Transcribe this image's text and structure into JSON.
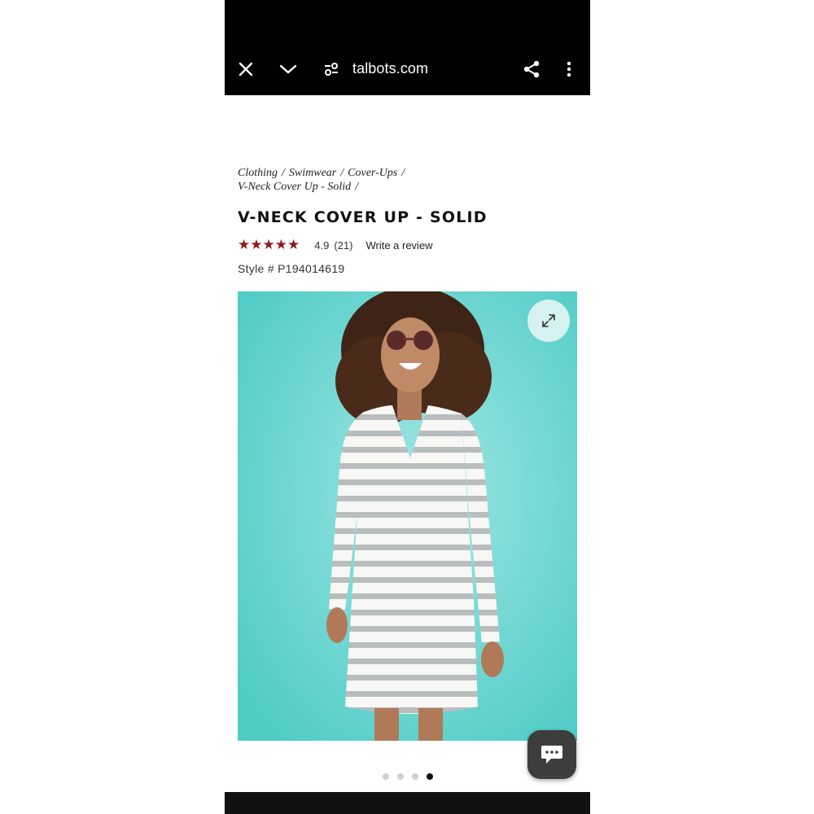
{
  "browser": {
    "url": "talbots.com",
    "icons": {
      "close": "close-icon",
      "chevron": "chevron-down-icon",
      "site_settings": "site-settings-icon",
      "share": "share-icon",
      "menu": "more-vertical-icon"
    }
  },
  "breadcrumb": {
    "items": [
      "Clothing",
      "Swimwear",
      "Cover-Ups",
      "V-Neck Cover Up - Solid"
    ],
    "separator": "/"
  },
  "product": {
    "title": "V-NECK COVER UP - SOLID",
    "rating": {
      "stars": 5,
      "star_glyph": "★",
      "value": "4.9",
      "count": "(21)",
      "write_review": "Write a review"
    },
    "style_number": "Style # P194014619"
  },
  "gallery": {
    "image_subject": "model in white striped v-neck cover up dress on teal background",
    "zoom_icon": "expand-icon",
    "total_slides": 4,
    "active_slide_index": 3
  },
  "chat": {
    "icon": "chat-bubble-icon"
  },
  "colors": {
    "star": "#8b1a1a",
    "image_background": "#66d4d0",
    "browser_bar": "#000000",
    "chat_button": "#3d3d3d"
  }
}
